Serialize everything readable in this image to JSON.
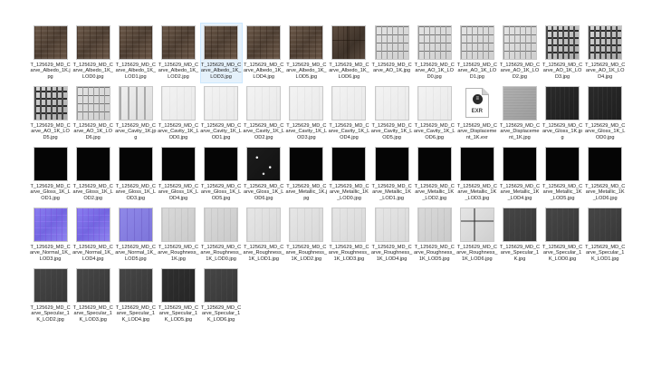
{
  "files": [
    {
      "name": "T_125629_MD_Carve_Albedo_1K.jpg",
      "thumb": "t-albedo"
    },
    {
      "name": "T_125629_MD_Carve_Albedo_1K_LOD0.jpg",
      "thumb": "t-albedo"
    },
    {
      "name": "T_125629_MD_Carve_Albedo_1K_LOD1.jpg",
      "thumb": "t-albedo"
    },
    {
      "name": "T_125629_MD_Carve_Albedo_1K_LOD2.jpg",
      "thumb": "t-albedo"
    },
    {
      "name": "T_125629_MD_Carve_Albedo_1K_LOD3.jpg",
      "thumb": "t-albedo",
      "selected": true
    },
    {
      "name": "T_125629_MD_Carve_Albedo_1K_LOD4.jpg",
      "thumb": "t-albedo"
    },
    {
      "name": "T_125629_MD_Carve_Albedo_1K_LOD5.jpg",
      "thumb": "t-albedo"
    },
    {
      "name": "T_125629_MD_Carve_Albedo_1K_LOD6.jpg",
      "thumb": "t-albedo-mix"
    },
    {
      "name": "T_125629_MD_Carve_AO_1K.jpg",
      "thumb": "t-ao"
    },
    {
      "name": "T_125629_MD_Carve_AO_1K_LOD0.jpg",
      "thumb": "t-ao"
    },
    {
      "name": "T_125629_MD_Carve_AO_1K_LOD1.jpg",
      "thumb": "t-ao"
    },
    {
      "name": "T_125629_MD_Carve_AO_1K_LOD2.jpg",
      "thumb": "t-ao"
    },
    {
      "name": "T_125629_MD_Carve_AO_1K_LOD3.jpg",
      "thumb": "t-ao-dark"
    },
    {
      "name": "T_125629_MD_Carve_AO_1K_LOD4.jpg",
      "thumb": "t-ao-dark"
    },
    {
      "name": "T_125629_MD_Carve_AO_1K_LOD5.jpg",
      "thumb": "t-ao-dark"
    },
    {
      "name": "T_125629_MD_Carve_AO_1K_LOD6.jpg",
      "thumb": "t-ao"
    },
    {
      "name": "T_125629_MD_Carve_Cavity_1K.jpg",
      "thumb": "t-ao-low"
    },
    {
      "name": "T_125629_MD_Carve_Cavity_1K_LOD0.jpg",
      "thumb": "t-cavity"
    },
    {
      "name": "T_125629_MD_Carve_Cavity_1K_LOD1.jpg",
      "thumb": "t-cavity"
    },
    {
      "name": "T_125629_MD_Carve_Cavity_1K_LOD2.jpg",
      "thumb": "t-cavity"
    },
    {
      "name": "T_125629_MD_Carve_Cavity_1K_LOD3.jpg",
      "thumb": "t-cavity"
    },
    {
      "name": "T_125629_MD_Carve_Cavity_1K_LOD4.jpg",
      "thumb": "t-cavity"
    },
    {
      "name": "T_125629_MD_Carve_Cavity_1K_LOD5.jpg",
      "thumb": "t-cavity"
    },
    {
      "name": "T_125629_MD_Carve_Cavity_1K_LOD6.jpg",
      "thumb": "t-cavity"
    },
    {
      "name": "T_125629_MD_Carve_Displacement_1K.exr",
      "thumb": "t-file",
      "ext": "EXR"
    },
    {
      "name": "T_125629_MD_Carve_Displacement_1K.jpg",
      "thumb": "t-disp"
    },
    {
      "name": "T_125629_MD_Carve_Gloss_1K.jpg",
      "thumb": "t-gloss"
    },
    {
      "name": "T_125629_MD_Carve_Gloss_1K_LOD0.jpg",
      "thumb": "t-gloss"
    },
    {
      "name": "T_125629_MD_Carve_Gloss_1K_LOD1.jpg",
      "thumb": "t-black"
    },
    {
      "name": "T_125629_MD_Carve_Gloss_1K_LOD2.jpg",
      "thumb": "t-black"
    },
    {
      "name": "T_125629_MD_Carve_Gloss_1K_LOD3.jpg",
      "thumb": "t-black"
    },
    {
      "name": "T_125629_MD_Carve_Gloss_1K_LOD4.jpg",
      "thumb": "t-black"
    },
    {
      "name": "T_125629_MD_Carve_Gloss_1K_LOD5.jpg",
      "thumb": "t-black"
    },
    {
      "name": "T_125629_MD_Carve_Gloss_1K_LOD6.jpg",
      "thumb": "t-gloss-dot"
    },
    {
      "name": "T_125629_MD_Carve_Metallic_1K.jpg",
      "thumb": "t-black"
    },
    {
      "name": "T_125629_MD_Carve_Metallic_1K_LOD0.jpg",
      "thumb": "t-black"
    },
    {
      "name": "T_125629_MD_Carve_Metallic_1K_LOD1.jpg",
      "thumb": "t-black"
    },
    {
      "name": "T_125629_MD_Carve_Metallic_1K_LOD2.jpg",
      "thumb": "t-black"
    },
    {
      "name": "T_125629_MD_Carve_Metallic_1K_LOD3.jpg",
      "thumb": "t-black"
    },
    {
      "name": "T_125629_MD_Carve_Metallic_1K_LOD4.jpg",
      "thumb": "t-black"
    },
    {
      "name": "T_125629_MD_Carve_Metallic_1K_LOD5.jpg",
      "thumb": "t-black"
    },
    {
      "name": "T_125629_MD_Carve_Metallic_1K_LOD6.jpg",
      "thumb": "t-black"
    },
    {
      "name": "T_125629_MD_Carve_Normal_1K_LOD3.jpg",
      "thumb": "t-normal"
    },
    {
      "name": "T_125629_MD_Carve_Normal_1K_LOD4.jpg",
      "thumb": "t-normal"
    },
    {
      "name": "T_125629_MD_Carve_Normal_1K_LOD5.jpg",
      "thumb": "t-normal-pale"
    },
    {
      "name": "T_125629_MD_Carve_Roughness_1K.jpg",
      "thumb": "t-rough"
    },
    {
      "name": "T_125629_MD_Carve_Roughness_1K_LOD0.jpg",
      "thumb": "t-rough"
    },
    {
      "name": "T_125629_MD_Carve_Roughness_1K_LOD1.jpg",
      "thumb": "t-rough-lt"
    },
    {
      "name": "T_125629_MD_Carve_Roughness_1K_LOD2.jpg",
      "thumb": "t-rough-lt"
    },
    {
      "name": "T_125629_MD_Carve_Roughness_1K_LOD3.jpg",
      "thumb": "t-rough-lt"
    },
    {
      "name": "T_125629_MD_Carve_Roughness_1K_LOD4.jpg",
      "thumb": "t-rough-lt"
    },
    {
      "name": "T_125629_MD_Carve_Roughness_1K_LOD5.jpg",
      "thumb": "t-rough"
    },
    {
      "name": "T_125629_MD_Carve_Roughness_1K_LOD6.jpg",
      "thumb": "t-rough-mix"
    },
    {
      "name": "T_125629_MD_Carve_Specular_1K.jpg",
      "thumb": "t-spec"
    },
    {
      "name": "T_125629_MD_Carve_Specular_1K_LOD0.jpg",
      "thumb": "t-spec"
    },
    {
      "name": "T_125629_MD_Carve_Specular_1K_LOD1.jpg",
      "thumb": "t-spec"
    },
    {
      "name": "T_125629_MD_Carve_Specular_1K_LOD2.jpg",
      "thumb": "t-spec"
    },
    {
      "name": "T_125629_MD_Carve_Specular_1K_LOD3.jpg",
      "thumb": "t-spec"
    },
    {
      "name": "T_125629_MD_Carve_Specular_1K_LOD4.jpg",
      "thumb": "t-spec"
    },
    {
      "name": "T_125629_MD_Carve_Specular_1K_LOD5.jpg",
      "thumb": "t-spec-dk"
    },
    {
      "name": "T_125629_MD_Carve_Specular_1K_LOD6.jpg",
      "thumb": "t-spec"
    }
  ],
  "colors": {
    "selected_bg": "#e5f1fb",
    "selected_border": "#cce8ff",
    "window_bg": "#ffffff"
  },
  "icons": {
    "generic_file": "file-icon"
  }
}
